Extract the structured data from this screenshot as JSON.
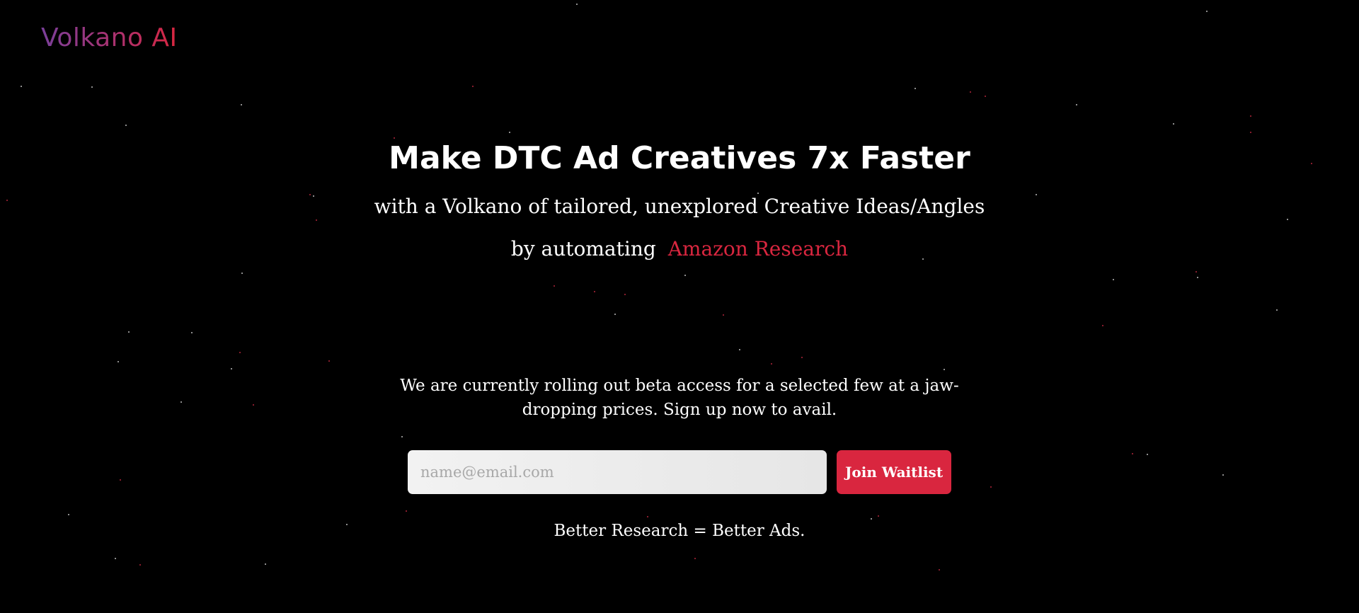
{
  "brand": {
    "logo_text": "Volkano AI",
    "accent_color": "#d9263f",
    "background_color": "#000000"
  },
  "hero": {
    "headline": "Make DTC Ad Creatives 7x Faster",
    "subheading_line1": "with a Volkano of tailored, unexplored Creative Ideas/Angles",
    "subheading_line2_prefix": "by automating",
    "subheading_line2_highlight": "Amazon Research"
  },
  "signup": {
    "notice": "We are currently rolling out beta access for a selected few at a jaw-dropping prices. Sign up now to avail.",
    "email_placeholder": "name@email.com",
    "email_value": "",
    "button_label": "Join Waitlist"
  },
  "footer": {
    "tagline": "Better Research = Better Ads."
  }
}
